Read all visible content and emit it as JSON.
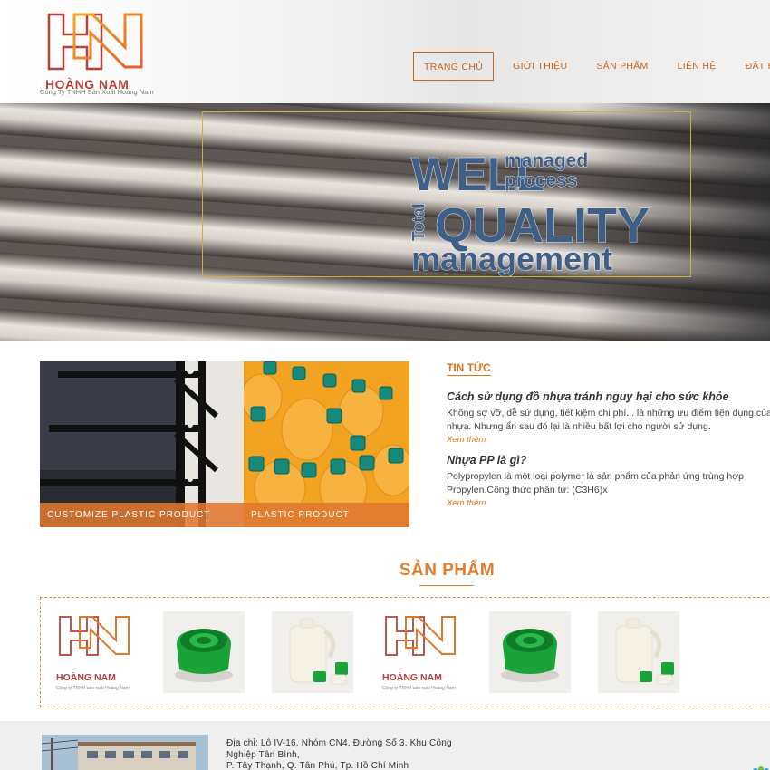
{
  "brand": {
    "name": "HOÀNG NAM",
    "tagline": "Công Ty TNHH Sản Xuất Hoàng Nam",
    "color": "#e07d2f",
    "secondary_color": "#b2433a"
  },
  "nav": {
    "items": [
      {
        "label": "TRANG CHỦ",
        "active": true
      },
      {
        "label": "GIỚI THIỆU",
        "active": false
      },
      {
        "label": "SẢN PHẨM",
        "active": false
      },
      {
        "label": "LIÊN HỆ",
        "active": false
      },
      {
        "label": "ĐẶT RIÊNG",
        "active": false
      }
    ]
  },
  "banner": {
    "word_cloud": {
      "well": "WELL",
      "managed": "managed",
      "process": "process",
      "total": "Total",
      "quality": "QUALITY",
      "management": "management"
    }
  },
  "features": [
    {
      "caption": "CUSTOMIZE PLASTIC PRODUCT"
    },
    {
      "caption": "PLASTIC PRODUCT"
    }
  ],
  "news": {
    "heading": "TIN TỨC",
    "items": [
      {
        "title": "Cách sử dụng đồ nhựa tránh nguy hại cho sức khỏe",
        "line1": "Không sợ vỡ, dễ sử dụng, tiết kiệm chi phí... là những ưu điểm tiện dụng của",
        "line2": "nhựa. Nhưng ẩn sau đó lại là nhiều bất lợi cho người sử dụng.",
        "more": "Xem thêm"
      },
      {
        "title": "Nhựa PP là gì?",
        "line1": "Polypropylen là một loại polymer là sản phẩm của phản ứng trùng hợp",
        "line2": "Propylen.Công thức phân tử: (C3H6)x",
        "more": "Xem thêm"
      }
    ]
  },
  "products": {
    "heading": "SẢN PHẨM",
    "logo_caption": "Công ty TNHH sản xuất Hoàng Nam",
    "items": [
      {
        "kind": "logo"
      },
      {
        "kind": "green-cap"
      },
      {
        "kind": "bottle"
      },
      {
        "kind": "logo"
      },
      {
        "kind": "green-cap"
      },
      {
        "kind": "bottle"
      }
    ]
  },
  "footer": {
    "address_line1": "Địa chỉ: Lô IV-16, Nhóm CN4, Đường Số 3, Khu Công",
    "address_line2": "Nghiệp Tân Bình,",
    "address_line3": "P. Tây Thạnh, Q. Tân Phú, Tp. Hồ Chí Minh"
  }
}
